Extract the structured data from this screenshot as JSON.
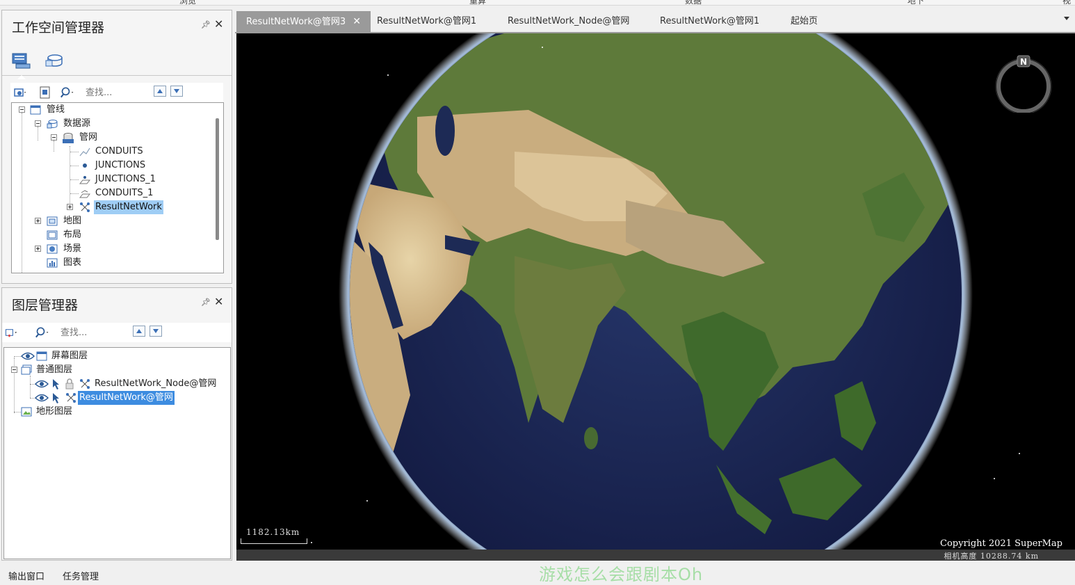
{
  "ribbon_tabs": [
    "浏览",
    "重算",
    "数据",
    "地下",
    "视"
  ],
  "workspace_panel": {
    "title": "工作空间管理器",
    "pin_icon": "pin-icon",
    "close_icon": "close-icon",
    "search_placeholder": "查找...",
    "tree": {
      "root": "管线",
      "datasources": "数据源",
      "datasource_name": "管网",
      "datasets": [
        "CONDUITS",
        "JUNCTIONS",
        "JUNCTIONS_1",
        "CONDUITS_1",
        "ResultNetWork"
      ],
      "maps": "地图",
      "layouts": "布局",
      "scenes": "场景",
      "charts": "图表"
    }
  },
  "layer_panel": {
    "title": "图层管理器",
    "search_placeholder": "查找...",
    "tree": {
      "screen_layers": "屏幕图层",
      "normal_layers": "普通图层",
      "layers": [
        "ResultNetWork_Node@管网",
        "ResultNetWork@管网"
      ],
      "terrain_layers": "地形图层"
    }
  },
  "doc_tabs": [
    {
      "label": "ResultNetWork@管网3",
      "active": true
    },
    {
      "label": "ResultNetWork@管网1",
      "active": false
    },
    {
      "label": "ResultNetWork_Node@管网",
      "active": false
    },
    {
      "label": "ResultNetWork@管网1",
      "active": false
    },
    {
      "label": "起始页",
      "active": false
    }
  ],
  "scene": {
    "scale_text": "1182.13km",
    "copyright": "Copyright 2021 SuperMap",
    "camera_height": "相机高度 10288.74 km",
    "compass_label": "N"
  },
  "bottom_tabs": [
    "输出窗口",
    "任务管理"
  ],
  "watermark": "游戏怎么会跟剧本Oh",
  "colors": {
    "selection": "#3d8ce0",
    "selection_light": "#9fcdf5",
    "ocean": "#1d2a55",
    "tab_active": "#9a9a9a"
  }
}
